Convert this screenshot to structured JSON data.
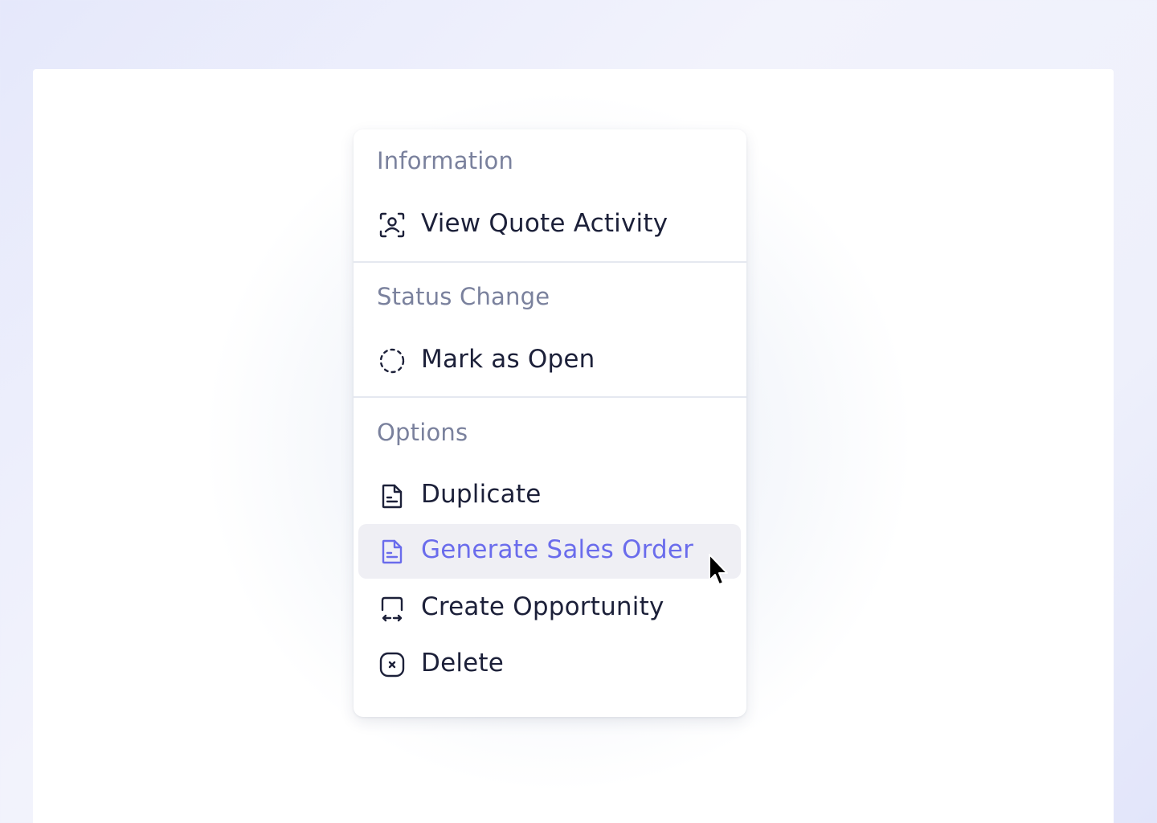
{
  "menu": {
    "sections": [
      {
        "header": "Information",
        "items": [
          {
            "label": "View Quote Activity",
            "icon": "user-scan-icon"
          }
        ]
      },
      {
        "header": "Status Change",
        "items": [
          {
            "label": "Mark as Open",
            "icon": "dashed-circle-icon"
          }
        ]
      },
      {
        "header": "Options",
        "items": [
          {
            "label": "Duplicate",
            "icon": "document-icon"
          },
          {
            "label": "Generate Sales Order",
            "icon": "document-icon",
            "state": "hovered"
          },
          {
            "label": "Create Opportunity",
            "icon": "exchange-icon"
          },
          {
            "label": "Delete",
            "icon": "close-square-icon"
          }
        ]
      }
    ]
  },
  "colors": {
    "accent": "#6a6cec",
    "text": "#1c2039",
    "muted": "#7a819d",
    "hover_bg": "#efeff4"
  }
}
